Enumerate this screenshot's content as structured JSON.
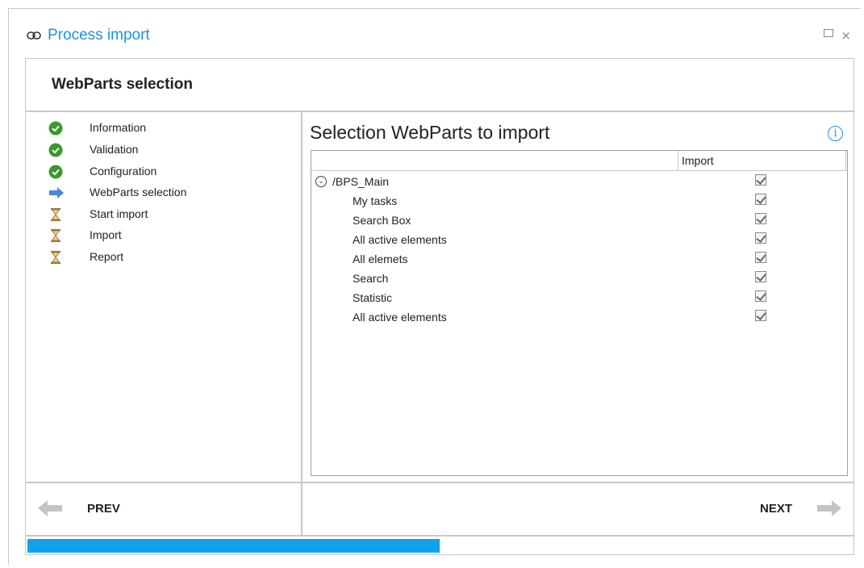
{
  "window": {
    "app_icon": "link-icon",
    "title": "Process import",
    "maximize_icon": "maximize-icon",
    "close_icon": "close-icon",
    "close_glyph": "×"
  },
  "header": {
    "title": "WebParts selection"
  },
  "steps": [
    {
      "label": "Information",
      "status": "done",
      "icon": "check-circle-icon"
    },
    {
      "label": "Validation",
      "status": "done",
      "icon": "check-circle-icon"
    },
    {
      "label": "Configuration",
      "status": "done",
      "icon": "check-circle-icon"
    },
    {
      "label": "WebParts selection",
      "status": "current",
      "icon": "arrow-right-icon"
    },
    {
      "label": "Start import",
      "status": "pending",
      "icon": "hourglass-icon"
    },
    {
      "label": "Import",
      "status": "pending",
      "icon": "hourglass-icon"
    },
    {
      "label": "Report",
      "status": "pending",
      "icon": "hourglass-icon"
    }
  ],
  "main": {
    "title": "Selection WebParts to import",
    "info_icon": "info-icon",
    "grid": {
      "column_import": "Import",
      "rows": [
        {
          "label": "/BPS_Main",
          "level": 0,
          "checked": true,
          "expandable": true
        },
        {
          "label": "My tasks",
          "level": 1,
          "checked": true
        },
        {
          "label": "Search Box",
          "level": 1,
          "checked": true
        },
        {
          "label": "All active elements",
          "level": 1,
          "checked": true
        },
        {
          "label": "All elemets",
          "level": 1,
          "checked": true
        },
        {
          "label": "Search",
          "level": 1,
          "checked": true
        },
        {
          "label": "Statistic",
          "level": 1,
          "checked": true
        },
        {
          "label": "All active elements",
          "level": 1,
          "checked": true
        }
      ]
    }
  },
  "footer": {
    "prev_label": "PREV",
    "next_label": "NEXT",
    "prev_icon": "arrow-left-icon",
    "next_icon": "arrow-right-icon"
  },
  "progress": {
    "value_percent": 50,
    "color": "#12a1ef"
  },
  "colors": {
    "accent": "#1e93d8",
    "done": "#3a9a2c",
    "current": "#4a86d8",
    "pending": "#e8b84a"
  }
}
